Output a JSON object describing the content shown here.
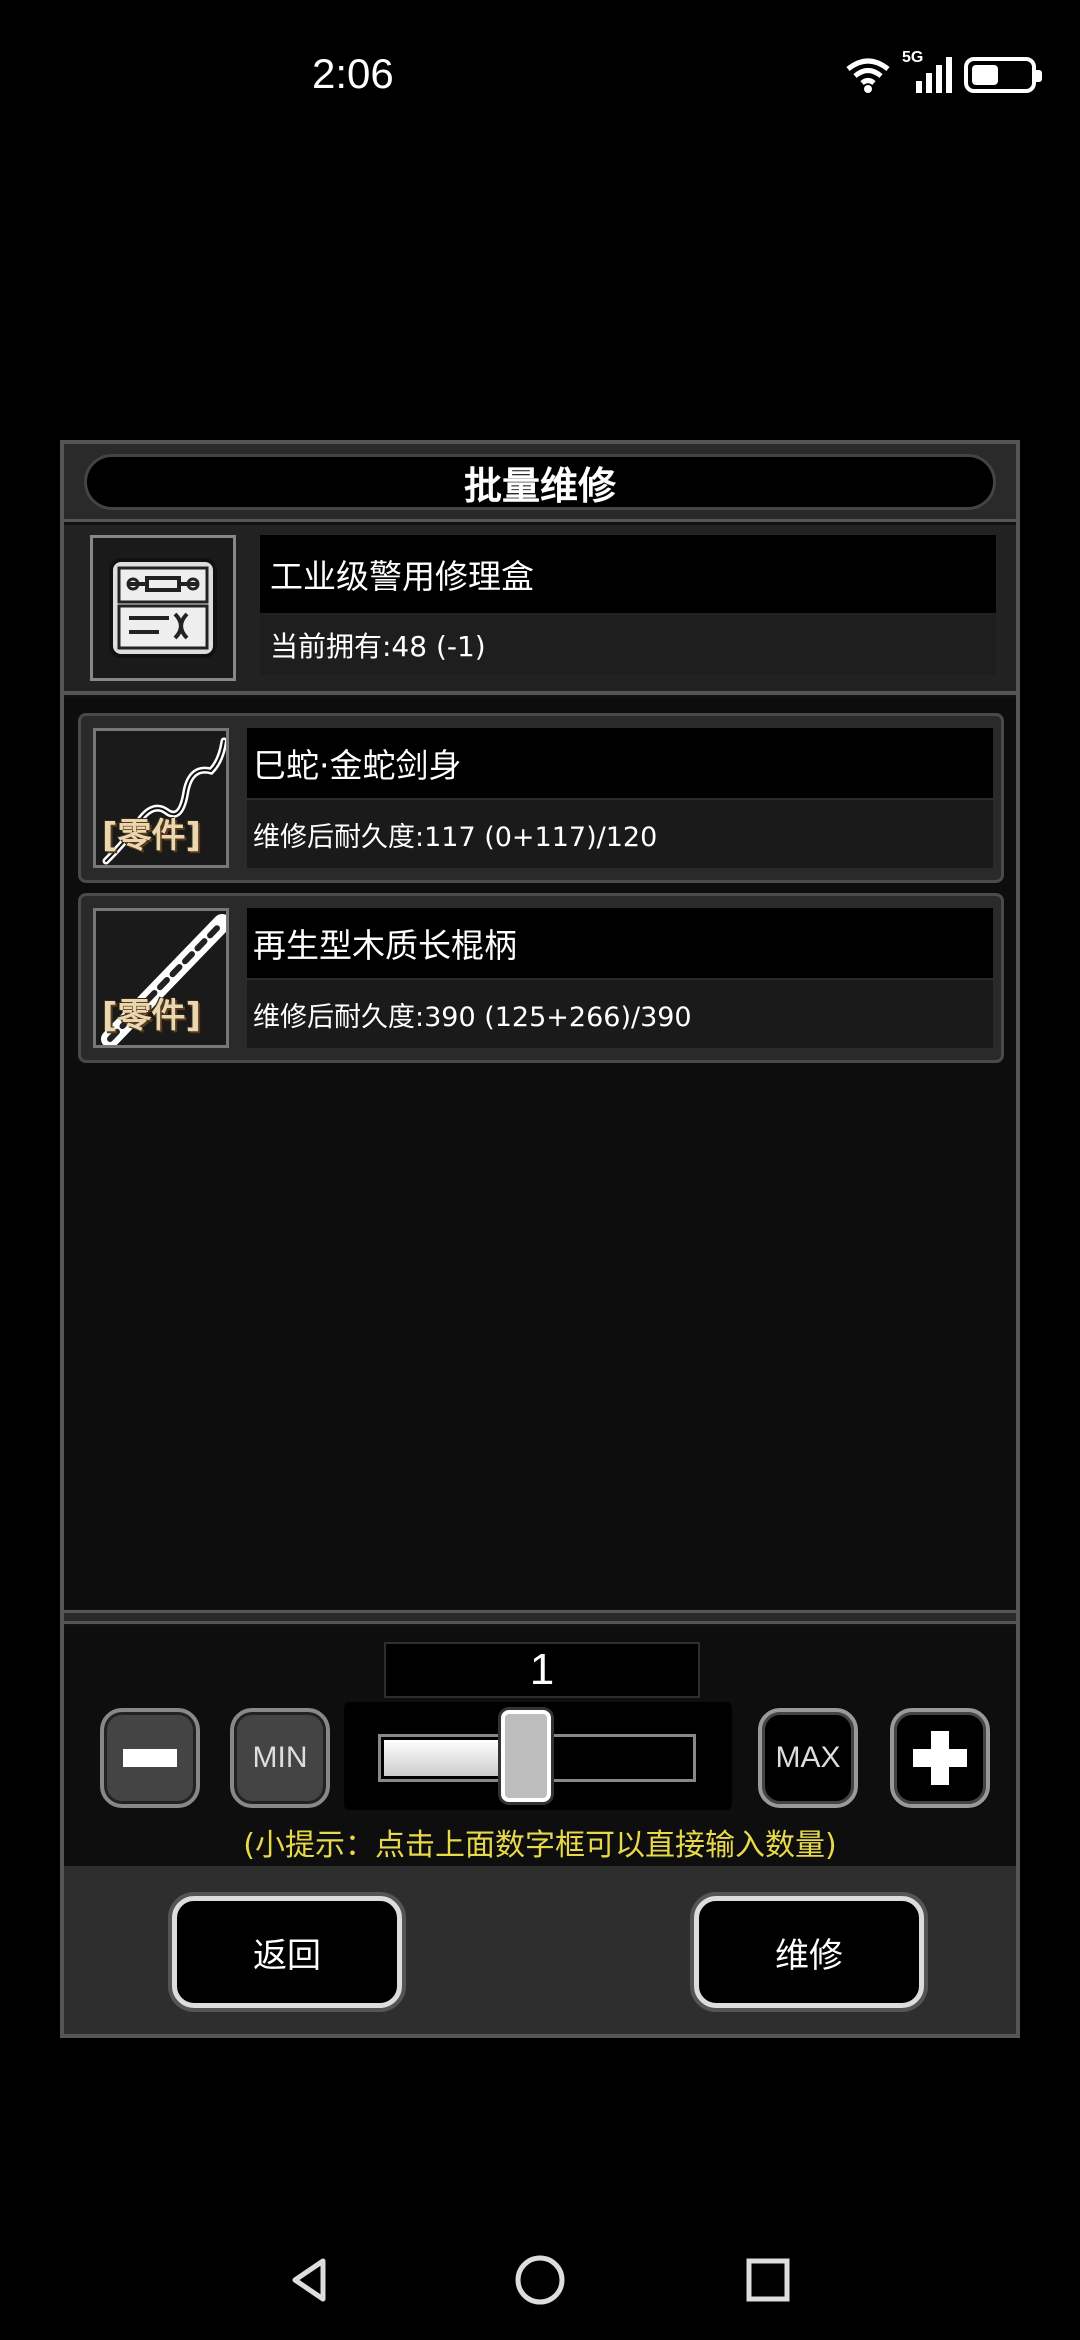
{
  "status_bar": {
    "time": "2:06",
    "network": "5G"
  },
  "dialog": {
    "title": "批量维修",
    "kit": {
      "name": "工业级警用修理盒",
      "owned": "当前拥有:48 (-1)",
      "icon": "repair-kit-icon"
    },
    "items": [
      {
        "name": "巳蛇·金蛇剑身",
        "durability": "维修后耐久度:117 (0+117)/120",
        "tag": "零件",
        "icon": "snake-blade-icon"
      },
      {
        "name": "再生型木质长棍柄",
        "durability": "维修后耐久度:390 (125+266)/390",
        "tag": "零件",
        "icon": "wooden-staff-icon"
      }
    ],
    "quantity": {
      "value": "1",
      "min_label": "MIN",
      "max_label": "MAX",
      "slider_fraction": 0.42
    },
    "hint": "(小提示：点击上面数字框可以直接输入数量)",
    "buttons": {
      "back": "返回",
      "repair": "维修"
    }
  },
  "colors": {
    "hint": "#e8d94a",
    "part_tag": "#e8d7b0"
  }
}
